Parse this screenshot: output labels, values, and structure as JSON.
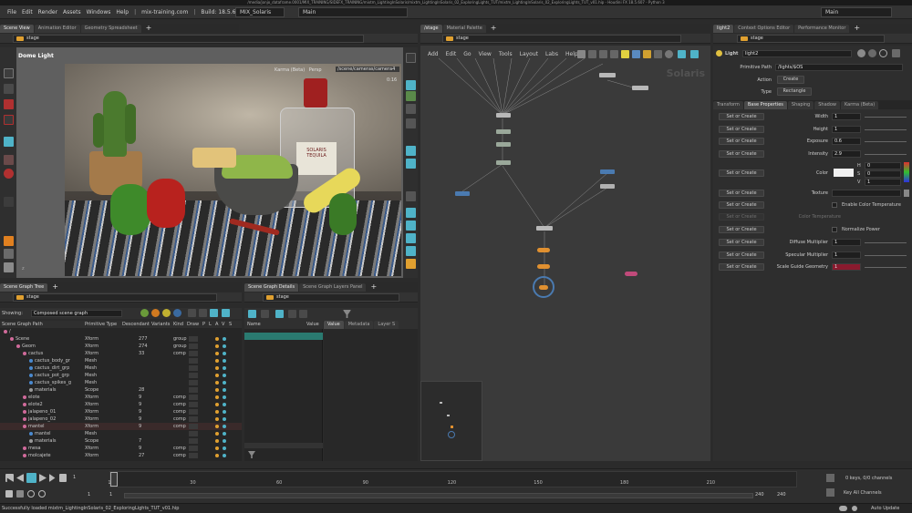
{
  "window": {
    "title": "/media/jonjo_dataframe.0001/MIX_TRAINING/SIDEFX_TRAINING/mixtm_LightingInSolaris/mixtm_LightingInSolaris_02_ExploringLights_TUT/mixtm_LightingInSolaris_02_ExploringLights_TUT_v01.hip - Houdini FX 18.5.607 - Python 3"
  },
  "menu": {
    "items": [
      "File",
      "Edit",
      "Render",
      "Assets",
      "Windows",
      "Help"
    ],
    "site": "mix-training.com",
    "build": "Build: 18.5.607",
    "desktop_left": "MIX_Solaris",
    "desktop_mid": "Main",
    "desktop_right": "Main"
  },
  "left_panel": {
    "tabs": [
      "Scene View",
      "Animation Editor",
      "Geometry Spreadsheet"
    ],
    "path": "stage",
    "viewport": {
      "light_label": "Dome Light",
      "renderer": "Karma (Beta)",
      "persp": "Persp",
      "camera": "/scene/cameras/camera4",
      "time": "0:16",
      "axis": "z",
      "sign_line1": "SOLARIS",
      "sign_line2": "TEQUILA"
    }
  },
  "network": {
    "tabs": [
      "/stage",
      "Material Palette"
    ],
    "path": "stage",
    "menu": [
      "Add",
      "Edit",
      "Go",
      "View",
      "Tools",
      "Layout",
      "Labs",
      "Help"
    ],
    "watermark": "Solaris"
  },
  "params": {
    "tabs": [
      "light2",
      "Context Options Editor",
      "Performance Monitor"
    ],
    "path": "stage",
    "node_type": "Light",
    "node_name": "light2",
    "primitive_path_label": "Primitive Path",
    "primitive_path": "/lights/$OS",
    "action_label": "Action",
    "action": "Create",
    "type_label": "Type",
    "type": "Rectangle",
    "ptabs": [
      "Transform",
      "Base Properties",
      "Shaping",
      "Shadow",
      "Karma (Beta)"
    ],
    "set_label": "Set or Create",
    "rows": [
      {
        "label": "Width",
        "value": "1"
      },
      {
        "label": "Height",
        "value": "1"
      },
      {
        "label": "Exposure",
        "value": "0.6"
      },
      {
        "label": "Intensity",
        "value": "2.9"
      }
    ],
    "color_label": "Color",
    "hsv": [
      {
        "k": "H",
        "v": "0"
      },
      {
        "k": "S",
        "v": "0"
      },
      {
        "k": "V",
        "v": "1"
      }
    ],
    "texture_label": "Texture",
    "enable_color_temp": "Enable Color Temperature",
    "color_temp_label": "Color Temperature",
    "normalize_power": "Normalize Power",
    "rows2": [
      {
        "label": "Diffuse Multiplier",
        "value": "1"
      },
      {
        "label": "Specular Multiplier",
        "value": "1"
      },
      {
        "label": "Scale Guide Geometry",
        "value": "1"
      }
    ]
  },
  "scene_graph": {
    "tab": "Scene Graph Tree",
    "path": "stage",
    "showing_label": "Showing:",
    "showing": "Composed scene graph",
    "columns": [
      "Scene Graph Path",
      "Primitive Type",
      "Descendant",
      "Variants",
      "Kind",
      "Draw",
      "P",
      "L",
      "A",
      "V",
      "S"
    ],
    "rows": [
      {
        "name": "/",
        "type": "",
        "desc": "",
        "kind": "",
        "lv": 0
      },
      {
        "name": "Scene",
        "type": "Xform",
        "desc": "277",
        "kind": "group",
        "lv": 1
      },
      {
        "name": "Geom",
        "type": "Xform",
        "desc": "274",
        "kind": "group",
        "lv": 2
      },
      {
        "name": "cactus",
        "type": "Xform",
        "desc": "33",
        "kind": "comp",
        "lv": 3
      },
      {
        "name": "cactus_body_gr",
        "type": "Mesh",
        "desc": "",
        "kind": "",
        "lv": 4
      },
      {
        "name": "cactus_dirt_grp",
        "type": "Mesh",
        "desc": "",
        "kind": "",
        "lv": 4
      },
      {
        "name": "cactus_pot_grp",
        "type": "Mesh",
        "desc": "",
        "kind": "",
        "lv": 4
      },
      {
        "name": "cactus_spikes_g",
        "type": "Mesh",
        "desc": "",
        "kind": "",
        "lv": 4
      },
      {
        "name": "materials",
        "type": "Scope",
        "desc": "28",
        "kind": "",
        "lv": 4
      },
      {
        "name": "elote",
        "type": "Xform",
        "desc": "9",
        "kind": "comp",
        "lv": 3
      },
      {
        "name": "elote2",
        "type": "Xform",
        "desc": "9",
        "kind": "comp",
        "lv": 3
      },
      {
        "name": "jalapeno_01",
        "type": "Xform",
        "desc": "9",
        "kind": "comp",
        "lv": 3
      },
      {
        "name": "jalapeno_02",
        "type": "Xform",
        "desc": "9",
        "kind": "comp",
        "lv": 3
      },
      {
        "name": "mantel",
        "type": "Xform",
        "desc": "9",
        "kind": "comp",
        "lv": 3
      },
      {
        "name": "mantel",
        "type": "Mesh",
        "desc": "",
        "kind": "",
        "lv": 4
      },
      {
        "name": "materials",
        "type": "Scope",
        "desc": "7",
        "kind": "",
        "lv": 4
      },
      {
        "name": "mesa",
        "type": "Xform",
        "desc": "9",
        "kind": "comp",
        "lv": 3
      },
      {
        "name": "molcajete",
        "type": "Xform",
        "desc": "27",
        "kind": "comp",
        "lv": 3
      }
    ]
  },
  "details": {
    "tabs": [
      "Scene Graph Details",
      "Scene Graph Layers Panel"
    ],
    "path": "stage",
    "col_name": "Name",
    "col_value": "Value",
    "sub_tabs": [
      "Value",
      "Metadata",
      "Layer S"
    ]
  },
  "timeline": {
    "frame": "1",
    "start": "1",
    "start2": "1",
    "end": "240",
    "end2": "240",
    "ticks": [
      "1",
      "30",
      "60",
      "90",
      "120",
      "150",
      "180",
      "210"
    ],
    "keys": "0 keys, 0/0 channels",
    "key_all": "Key All Channels",
    "auto_update": "Auto Update"
  },
  "status": "Successfully loaded mixtm_LightingInSolaris_02_ExploringLights_TUT_v01.hip",
  "colors": {
    "accent": "#4fb3c8",
    "folder": "#e0a030",
    "guide_color": "#8a1a2e"
  }
}
